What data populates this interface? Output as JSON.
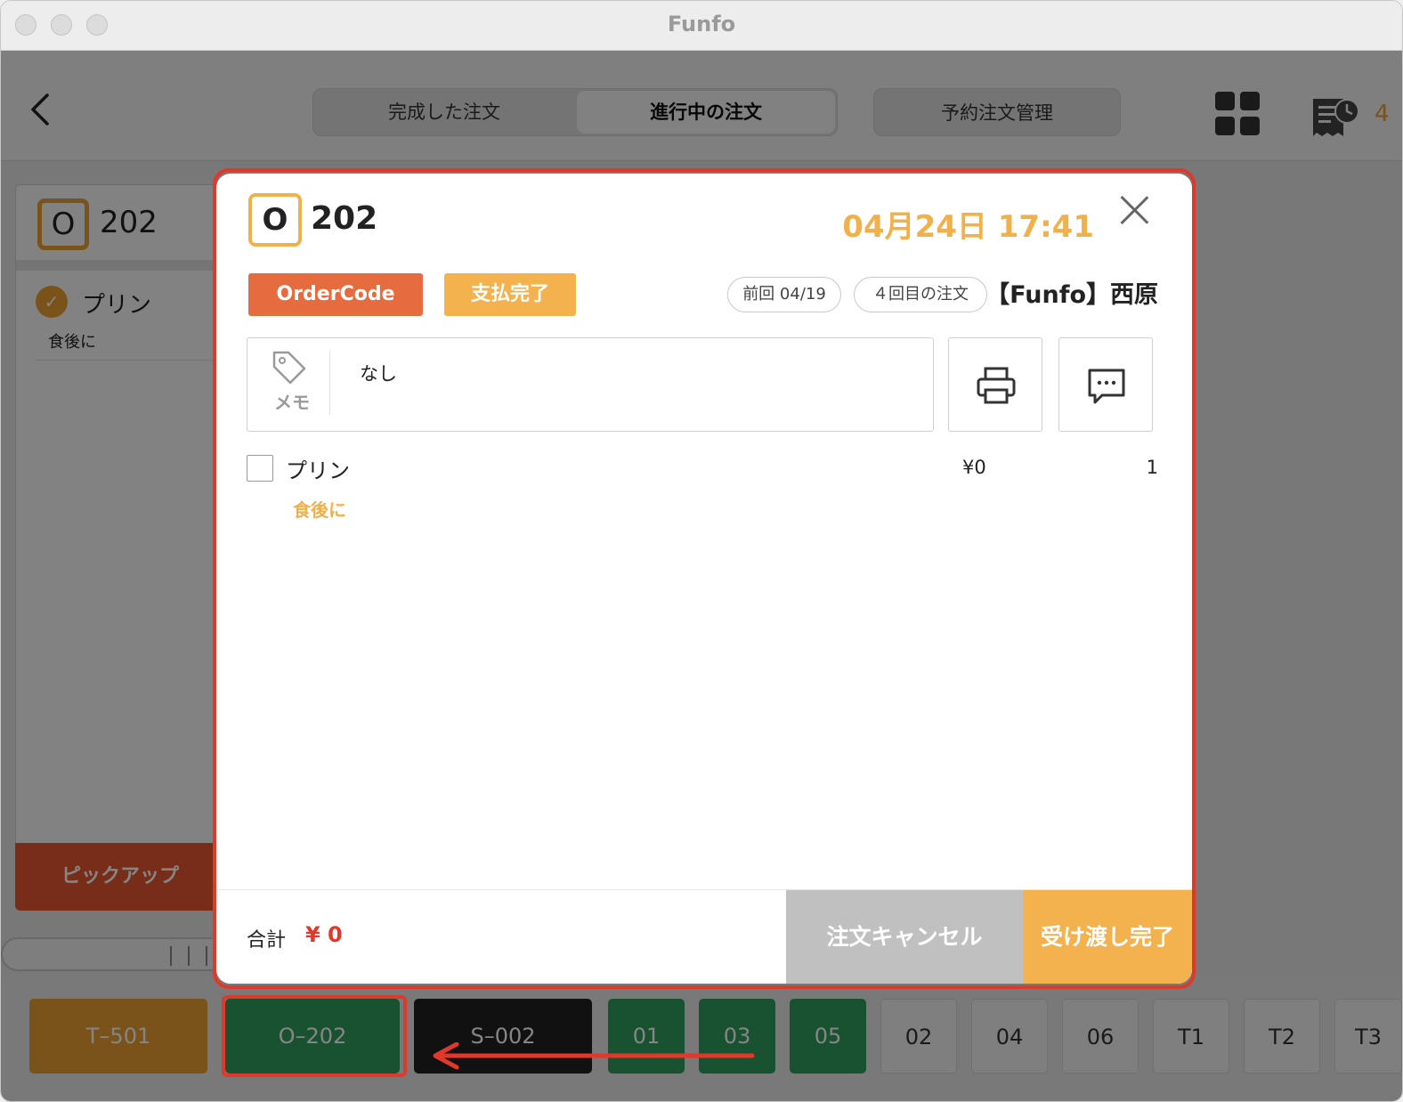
{
  "window": {
    "title": "Funfo"
  },
  "topbar": {
    "tabs": [
      {
        "label": "完成した注文"
      },
      {
        "label": "進行中の注文"
      }
    ],
    "reserve_label": "予約注文管理",
    "receipt_count": "4"
  },
  "left_card": {
    "badge": "O",
    "number": "202",
    "item": "プリン",
    "note": "食後に",
    "pickup_label": "ピックアップ"
  },
  "tables": [
    {
      "label": "T–501",
      "status": "orange"
    },
    {
      "label": "O–202",
      "status": "green"
    },
    {
      "label": "S–002",
      "status": "black"
    },
    {
      "label": "01",
      "status": "green"
    },
    {
      "label": "03",
      "status": "green"
    },
    {
      "label": "05",
      "status": "green"
    },
    {
      "label": "02",
      "status": "gray"
    },
    {
      "label": "04",
      "status": "gray"
    },
    {
      "label": "06",
      "status": "gray"
    },
    {
      "label": "T1",
      "status": "gray"
    },
    {
      "label": "T2",
      "status": "gray"
    },
    {
      "label": "T3",
      "status": "gray"
    }
  ],
  "modal": {
    "badge": "O",
    "number": "202",
    "datetime": "04月24日 17:41",
    "tag_order": "OrderCode",
    "tag_paid": "支払完了",
    "last_visit": "前回 04/19",
    "visit_count": "４回目の注文",
    "shop_name": "【Funfo】西原",
    "memo_label": "メモ",
    "memo_text": "なし",
    "items": [
      {
        "name": "プリン",
        "price": "¥0",
        "qty": "1",
        "note": "食後に"
      }
    ],
    "total_label": "合計",
    "total_value": "¥ 0",
    "cancel_label": "注文キャンセル",
    "done_label": "受け渡し完了"
  },
  "colors": {
    "accent": "#f3b24e",
    "order_tag": "#e66b3e",
    "highlight": "#e0382a",
    "table_green": "#2f9e5e"
  }
}
